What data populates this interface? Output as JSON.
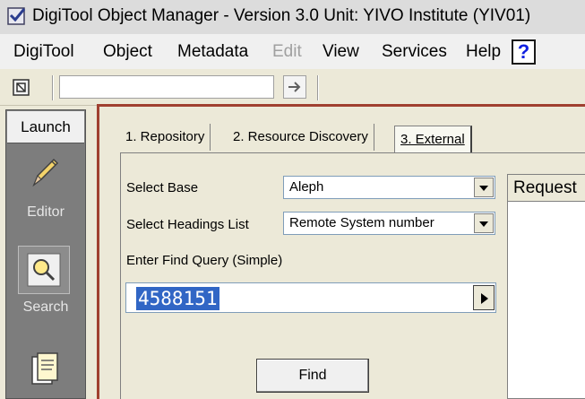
{
  "window": {
    "title": "DigiTool Object Manager - Version 3.0     Unit:  YIVO Institute (YIV01)"
  },
  "menu": {
    "items": [
      "DigiTool",
      "Object",
      "Metadata",
      "Edit",
      "View",
      "Services",
      "Help"
    ],
    "disabled": [
      "Edit"
    ],
    "help_button": "?"
  },
  "toolbar": {
    "input_value": ""
  },
  "launch": {
    "tab_label": "Launch",
    "items": [
      "Editor",
      "Search"
    ]
  },
  "tabs": [
    {
      "label": "1. Repository",
      "active": false
    },
    {
      "label": "2. Resource Discovery",
      "active": false
    },
    {
      "label": "3. External",
      "active": true
    }
  ],
  "form": {
    "select_base_label": "Select Base",
    "select_base_value": "Aleph",
    "headings_label": "Select Headings List",
    "headings_value": "Remote System number",
    "query_label": "Enter Find Query (Simple)",
    "query_value": "4588151",
    "find_button": "Find"
  },
  "request_panel": {
    "header": "Request"
  },
  "colors": {
    "frame_border": "#a04030",
    "selection": "#3166c5",
    "help_text": "#1020e0"
  }
}
